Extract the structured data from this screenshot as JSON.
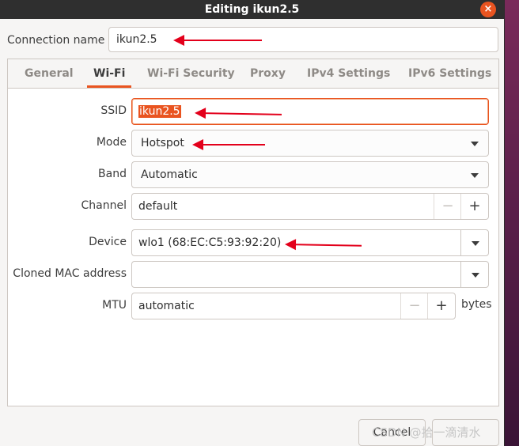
{
  "window": {
    "title": "Editing ikun2.5",
    "close_label": "×"
  },
  "connection": {
    "label": "Connection name",
    "value": "ikun2.5"
  },
  "tabs": [
    {
      "label": "General"
    },
    {
      "label": "Wi-Fi"
    },
    {
      "label": "Wi-Fi Security"
    },
    {
      "label": "Proxy"
    },
    {
      "label": "IPv4 Settings"
    },
    {
      "label": "IPv6 Settings"
    }
  ],
  "active_tab": "Wi-Fi",
  "wifi": {
    "ssid": {
      "label": "SSID",
      "value": "ikun2.5"
    },
    "mode": {
      "label": "Mode",
      "value": "Hotspot"
    },
    "band": {
      "label": "Band",
      "value": "Automatic"
    },
    "channel": {
      "label": "Channel",
      "value": "default",
      "minus": "−",
      "plus": "+"
    },
    "device": {
      "label": "Device",
      "value": "wlo1 (68:EC:C5:93:92:20)"
    },
    "cloned_mac": {
      "label": "Cloned MAC address",
      "value": ""
    },
    "mtu": {
      "label": "MTU",
      "value": "automatic",
      "minus": "−",
      "plus": "+",
      "unit": "bytes"
    }
  },
  "buttons": {
    "cancel": "Cancel"
  },
  "watermark": "CSDN @拾一滴清水",
  "colors": {
    "accent": "#e95420",
    "annotation_arrow": "#e3001b",
    "titlebar": "#2f2f2f"
  }
}
